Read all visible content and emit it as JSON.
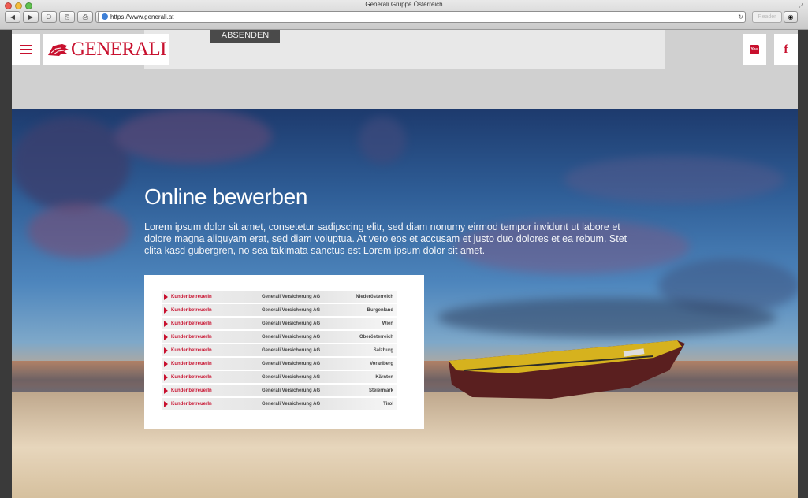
{
  "browser": {
    "window_title": "Generali Gruppe Österreich",
    "url": "https://www.generali.at",
    "reader_label": "Reader",
    "nav_buttons": [
      "◀",
      "▶",
      "⎔",
      "⎘",
      "⎙",
      "+"
    ]
  },
  "header": {
    "logo_text": "GENERALI",
    "submit_label": "ABSENDEN",
    "social": [
      {
        "icon": "youtube-icon",
        "label": "You Tube"
      },
      {
        "icon": "facebook-icon",
        "label": "f"
      }
    ]
  },
  "hero": {
    "title": "Online bewerben",
    "text": "Lorem ipsum dolor sit amet, consetetur sadipscing elitr, sed diam nonumy eirmod tempor invidunt ut labore et dolore magna aliquyam erat, sed diam voluptua. At vero eos et accusam et justo duo dolores et ea rebum. Stet clita kasd gubergren, no sea takimata sanctus est Lorem ipsum dolor sit amet."
  },
  "jobs": [
    {
      "title": "KundenbetreuerIn",
      "company": "Generali Versicherung AG",
      "region": "Niederösterreich"
    },
    {
      "title": "KundenbetreuerIn",
      "company": "Generali Versicherung AG",
      "region": "Burgenland"
    },
    {
      "title": "KundenbetreuerIn",
      "company": "Generali Versicherung AG",
      "region": "Wien"
    },
    {
      "title": "KundenbetreuerIn",
      "company": "Generali Versicherung AG",
      "region": "Oberösterreich"
    },
    {
      "title": "KundenbetreuerIn",
      "company": "Generali Versicherung AG",
      "region": "Salzburg"
    },
    {
      "title": "KundenbetreuerIn",
      "company": "Generali Versicherung AG",
      "region": "Vorarlberg"
    },
    {
      "title": "KundenbetreuerIn",
      "company": "Generali Versicherung AG",
      "region": "Kärnten"
    },
    {
      "title": "KundenbetreuerIn",
      "company": "Generali Versicherung AG",
      "region": "Steiermark"
    },
    {
      "title": "KundenbetreuerIn",
      "company": "Generali Versicherung AG",
      "region": "Tirol"
    }
  ],
  "colors": {
    "brand": "#c8102e"
  }
}
